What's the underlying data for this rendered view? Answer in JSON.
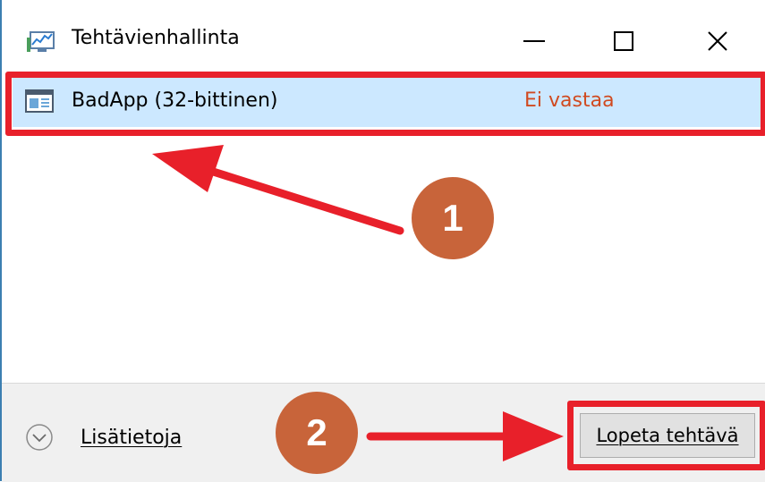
{
  "window": {
    "title": "Tehtävienhallinta",
    "controls": {
      "minimize": "—",
      "maximize": "☐",
      "close": "✕"
    }
  },
  "process": {
    "name": "BadApp (32-bittinen)",
    "status": "Ei vastaa"
  },
  "footer": {
    "more_details": "Lisätietoja",
    "end_task": "Lopeta tehtävä"
  },
  "annotations": {
    "step1": "1",
    "step2": "2",
    "highlight_color": "#e8202a",
    "badge_color": "#c8643a"
  }
}
